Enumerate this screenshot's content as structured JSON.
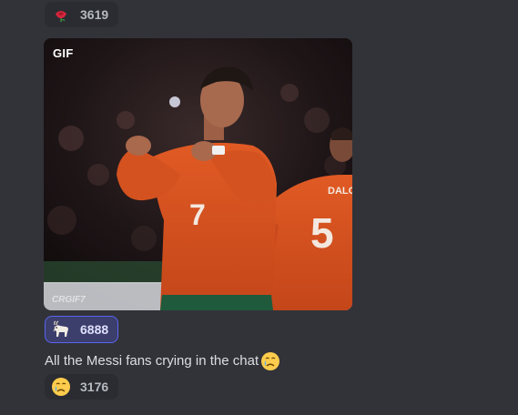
{
  "reactions_top": [
    {
      "emoji": "rose-emoji",
      "count": "3619",
      "active": false
    }
  ],
  "gif": {
    "badge": "GIF",
    "watermark": "CRGIF7",
    "jersey_number_front": "7",
    "jersey_number_back": "5",
    "jersey_name_back": "DALO"
  },
  "reactions_gif": [
    {
      "emoji": "goat-emoji",
      "count": "6888",
      "active": true
    }
  ],
  "message": {
    "text": "All the Messi fans crying in the chat",
    "emoji": "crying-face-emoji"
  },
  "reactions_bottom": [
    {
      "emoji": "crying-face-emoji",
      "count": "3176",
      "active": false
    }
  ],
  "colors": {
    "background": "#323339",
    "reaction_bg": "#2b2c31",
    "reaction_active_bg": "#3c3e6b",
    "reaction_active_border": "#5865f2",
    "jersey": "#d9501f"
  }
}
